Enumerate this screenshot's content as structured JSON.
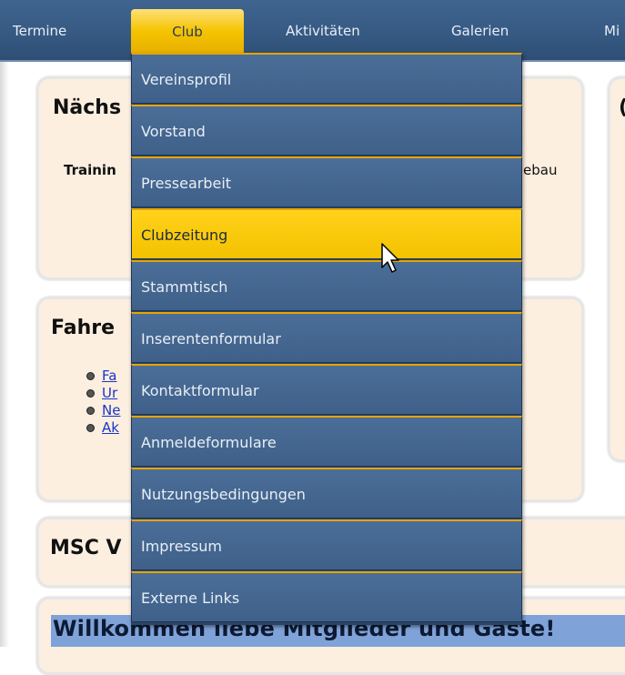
{
  "nav": {
    "items": [
      {
        "label": "Termine"
      },
      {
        "label": "Club"
      },
      {
        "label": "Aktivitäten"
      },
      {
        "label": "Galerien"
      },
      {
        "label": "Mi"
      }
    ],
    "active_index": 1
  },
  "dropdown": {
    "items": [
      {
        "label": "Vereinsprofil"
      },
      {
        "label": "Vorstand"
      },
      {
        "label": "Pressearbeit"
      },
      {
        "label": "Clubzeitung"
      },
      {
        "label": "Stammtisch"
      },
      {
        "label": "Inserentenformular"
      },
      {
        "label": "Kontaktformular"
      },
      {
        "label": "Anmeldeformulare"
      },
      {
        "label": "Nutzungsbedingungen"
      },
      {
        "label": "Impressum"
      },
      {
        "label": "Externe Links"
      }
    ],
    "hover_index": 3
  },
  "boxes": {
    "next": {
      "title": "Nächs",
      "line1_left": "Trainin",
      "line1_right": "ebau"
    },
    "fahrer": {
      "title": "Fahre",
      "links": [
        "Fa",
        "Ur",
        "Ne",
        "Ak"
      ]
    },
    "msc": {
      "title": "MSC V"
    },
    "right_partial": {
      "title": "("
    }
  },
  "welcome": {
    "text": "Willkommen liebe Mitglieder und Gäste!"
  },
  "colors": {
    "nav_bg": "#365a83",
    "nav_active": "#f5c400",
    "menu_item": "#4b6e98",
    "menu_item_hover": "#f3c200",
    "menu_separator": "#e8a400",
    "box_bg": "#fcefdf",
    "welcome_bg": "#7fa3d8"
  }
}
